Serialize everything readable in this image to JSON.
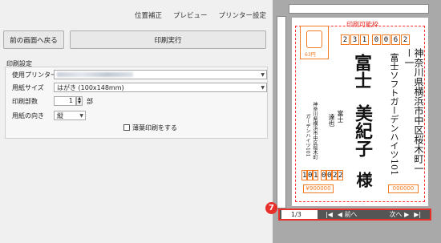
{
  "menu": {
    "position_adjust": "位置補正",
    "preview": "プレビュー",
    "printer_settings": "プリンター設定"
  },
  "buttons": {
    "back": "前の画面へ戻る",
    "print": "印刷実行"
  },
  "settings": {
    "title": "印刷設定",
    "printer_label": "使用プリンター",
    "paper_size_label": "用紙サイズ",
    "paper_size_value": "はがき (100x148mm)",
    "copies_label": "印刷部数",
    "copies_value": "1",
    "copies_unit": "部",
    "orientation_label": "用紙の向き",
    "orientation_value": "縦",
    "thin_paper_label": "薄葉印刷をする"
  },
  "preview": {
    "printable_label": "印刷可能枠",
    "zip": [
      "2",
      "3",
      "1",
      "0",
      "0",
      "6",
      "2"
    ],
    "address_line1": "神奈川県横浜市中区桜木町一ー一",
    "address_line2": "富士ソフトガーデンハイツ101",
    "recipient_surname": "富士",
    "recipient_given": "美紀子",
    "honorific": "様",
    "sender_name1": "富士",
    "sender_name2": "達也",
    "sender_addr1": "神奈川県横浜市中区桜木町",
    "sender_addr2": "ガーデンハイツ101",
    "sender_zip": [
      "1",
      "0",
      "1",
      "0",
      "0",
      "2",
      "2"
    ],
    "stamp_price": "63円",
    "lottery_left": "¥900000",
    "lottery_right": "000000"
  },
  "nav": {
    "page": "1/3",
    "prev": "前へ",
    "next": "次へ"
  },
  "badge": "7"
}
